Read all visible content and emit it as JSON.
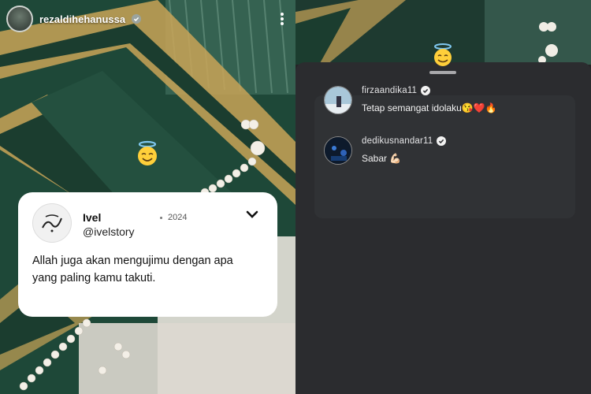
{
  "story": {
    "username": "rezaldihehanussa",
    "card": {
      "name": "Ivel",
      "handle": "@ivelstory",
      "year": "2024",
      "text": "Allah juga akan mengujimu dengan apa yang paling kamu takuti."
    }
  },
  "comments": [
    {
      "username": "firzaandika11",
      "text": "Tetap semangat idolaku😘❤️🔥"
    },
    {
      "username": "dedikusnandar11",
      "text": "Sabar 💪🏻"
    }
  ],
  "colors": {
    "rug_green": "#1f4a3a",
    "rug_gold": "#c9a457",
    "sheet_bg": "#2b2c2f",
    "card_bg": "#ffffff"
  }
}
